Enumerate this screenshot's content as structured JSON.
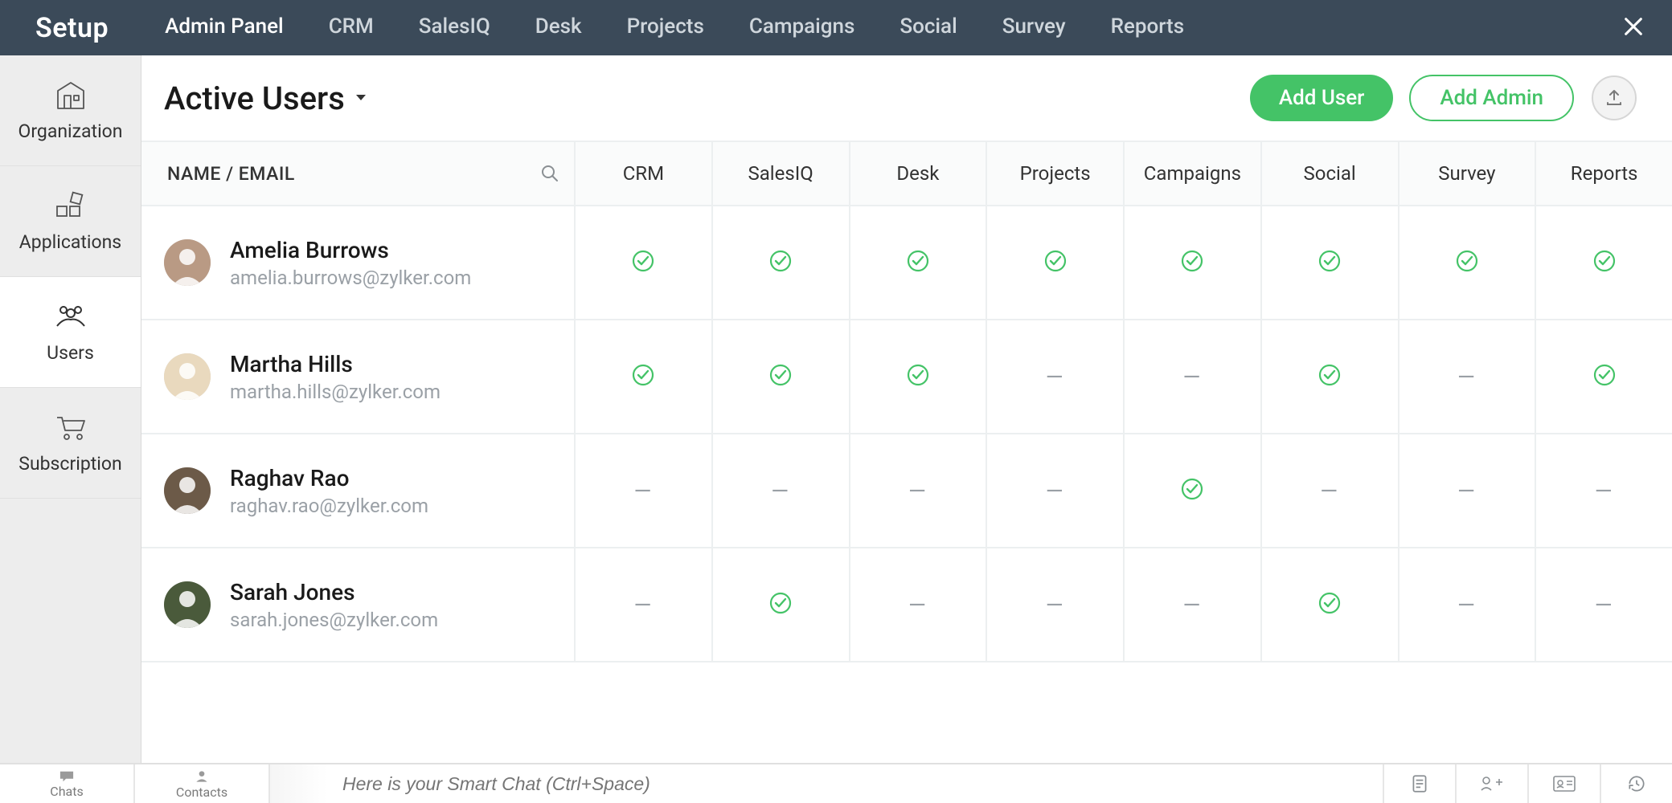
{
  "brand": "Setup",
  "topnav": [
    {
      "label": "Admin Panel",
      "active": true
    },
    {
      "label": "CRM"
    },
    {
      "label": "SalesIQ"
    },
    {
      "label": "Desk"
    },
    {
      "label": "Projects"
    },
    {
      "label": "Campaigns"
    },
    {
      "label": "Social"
    },
    {
      "label": "Survey"
    },
    {
      "label": "Reports"
    }
  ],
  "sidebar": [
    {
      "label": "Organization",
      "icon": "building"
    },
    {
      "label": "Applications",
      "icon": "apps"
    },
    {
      "label": "Users",
      "icon": "users",
      "active": true
    },
    {
      "label": "Subscription",
      "icon": "cart"
    }
  ],
  "page_title": "Active Users",
  "add_user_label": "Add User",
  "add_admin_label": "Add Admin",
  "columns": {
    "name_email": "NAME / EMAIL",
    "services": [
      "CRM",
      "SalesIQ",
      "Desk",
      "Projects",
      "Campaigns",
      "Social",
      "Survey",
      "Reports"
    ]
  },
  "avatar_colors": [
    "#b99a84",
    "#e9d9be",
    "#6c5a48",
    "#4a5a3b"
  ],
  "users": [
    {
      "name": "Amelia Burrows",
      "email": "amelia.burrows@zylker.com",
      "access": [
        true,
        true,
        true,
        true,
        true,
        true,
        true,
        true
      ]
    },
    {
      "name": "Martha Hills",
      "email": "martha.hills@zylker.com",
      "access": [
        true,
        true,
        true,
        false,
        false,
        true,
        false,
        true
      ]
    },
    {
      "name": "Raghav Rao",
      "email": "raghav.rao@zylker.com",
      "access": [
        false,
        false,
        false,
        false,
        true,
        false,
        false,
        false
      ]
    },
    {
      "name": "Sarah Jones",
      "email": "sarah.jones@zylker.com",
      "access": [
        false,
        true,
        false,
        false,
        false,
        true,
        false,
        false
      ]
    }
  ],
  "bottombar": {
    "chats": "Chats",
    "contacts": "Contacts",
    "placeholder": "Here is your Smart Chat (Ctrl+Space)"
  }
}
